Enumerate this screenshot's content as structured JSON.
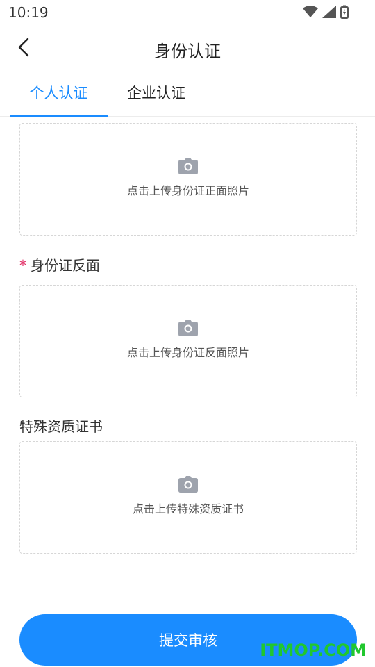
{
  "status_bar": {
    "time": "10:19"
  },
  "header": {
    "title": "身份认证"
  },
  "tabs": [
    {
      "label": "个人认证",
      "active": true
    },
    {
      "label": "企业认证",
      "active": false
    }
  ],
  "uploads": {
    "id_front": {
      "label": "点击上传身份证正面照片"
    },
    "id_back": {
      "section_title": "身份证反面",
      "required_mark": "*",
      "label": "点击上传身份证反面照片"
    },
    "certificate": {
      "section_title": "特殊资质证书",
      "label": "点击上传特殊资质证书"
    }
  },
  "submit": {
    "label": "提交审核"
  },
  "watermark": "ITMOP.COM",
  "colors": {
    "accent": "#1a8cff",
    "required": "#e0245e",
    "watermark": "#21c72e"
  },
  "icons": [
    "wifi-icon",
    "signal-icon",
    "battery-icon",
    "back-arrow-icon",
    "camera-icon"
  ]
}
